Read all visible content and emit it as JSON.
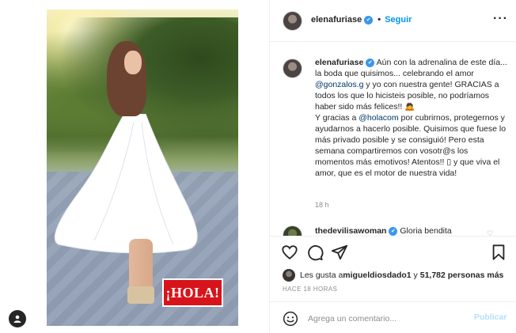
{
  "post": {
    "image_badge": "¡HOLA!",
    "author": "elenafuriase",
    "separator": "•",
    "follow_label": "Seguir",
    "more_label": "···",
    "caption": {
      "username": "elenafuriase",
      "part1": " Aún con la adrenalina de este día... la boda que quisimos... celebrando el amor ",
      "mention1": "@gonzalos.g",
      "part2": " y yo con nuestra gente! GRACIAS a todos los que lo hicisteis posible, no podríamos haber sido más felices!! 🙇",
      "part3": " Y gracias a ",
      "mention2": "@holacom",
      "part4": " por cubrirnos, protegernos y ayudarnos a hacerlo posible. Quisimos que fuese lo más privado posible y se consiguió! Pero esta semana compartiremos con vosotr@s los momentos más emotivos! Atentos!! ▯ y que viva el amor, que es el motor de nuestra vida!",
      "time": "18 h"
    },
    "comment2": {
      "username": "thedevilisawoman",
      "text": "Gloria bendita"
    },
    "likes": {
      "prefix": "Les gusta a ",
      "user": "migueldiosdado1",
      "middle": " y ",
      "count": "51,782 personas más"
    },
    "time_ago": "HACE 18 HORAS",
    "comment_placeholder": "Agrega un comentario...",
    "publish_label": "Publicar"
  },
  "icons": {
    "verified": "verified-badge-icon",
    "like": "heart-icon",
    "comment": "comment-icon",
    "share": "paper-plane-icon",
    "save": "bookmark-icon",
    "emoji": "smiley-icon"
  },
  "colors": {
    "link": "#0095f6",
    "verified": "#3897f0",
    "mention": "#00376b",
    "hola_red": "#d7141b",
    "muted": "#8e8e8e"
  }
}
